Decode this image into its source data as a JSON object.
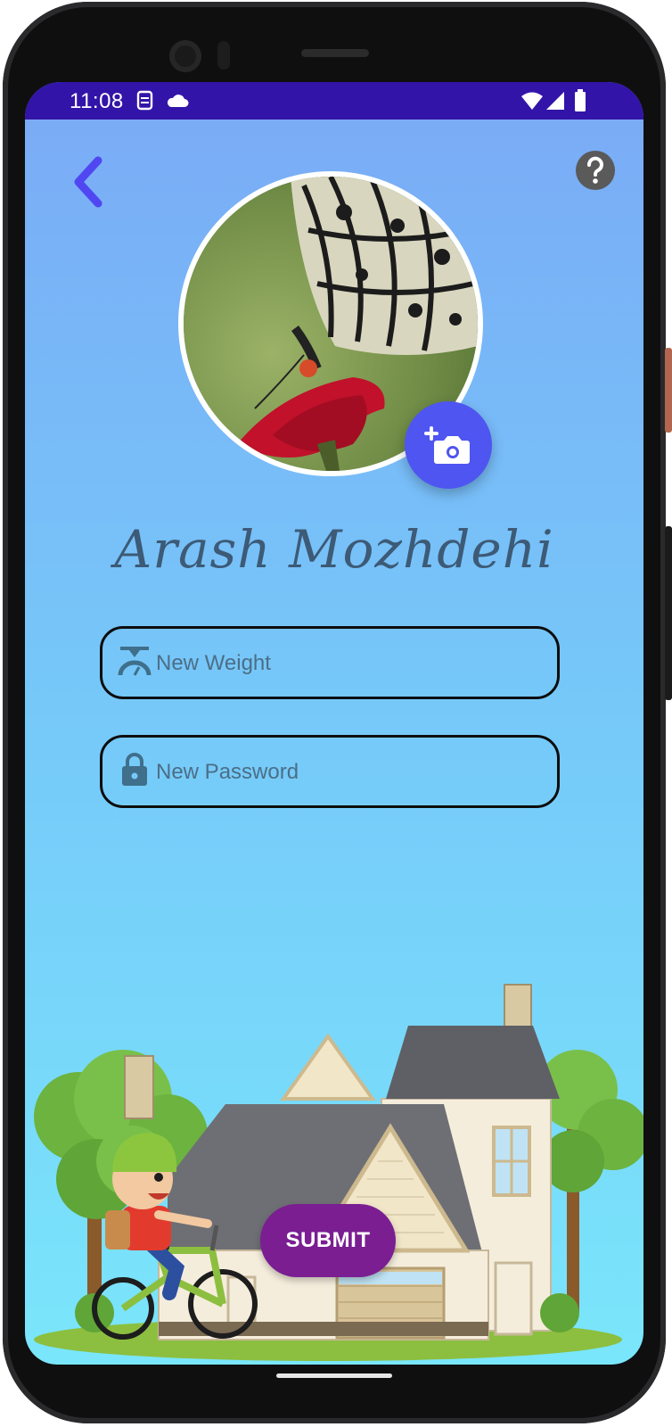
{
  "status_bar": {
    "time": "11:08",
    "icons": [
      "sim-icon",
      "cloud-icon",
      "wifi-icon",
      "signal-icon",
      "battery-icon"
    ],
    "background": "#3314a8"
  },
  "header": {
    "back_icon": "chevron-left-icon",
    "help_icon": "help-circle-icon"
  },
  "profile": {
    "name": "Arash Mozhdehi",
    "avatar": "butterfly-photo",
    "change_photo_icon": "add-a-photo-icon"
  },
  "form": {
    "weight_placeholder": "New Weight",
    "weight_icon": "scale-icon",
    "password_placeholder": "New Password",
    "password_icon": "lock-icon",
    "submit_label": "SUBMIT"
  },
  "colors": {
    "accent": "#4f55f0",
    "submit": "#7a1e92",
    "back_arrow": "#5047f2",
    "name_text": "#3d5a76"
  },
  "illustration": "boy-on-bicycle-in-front-of-house"
}
